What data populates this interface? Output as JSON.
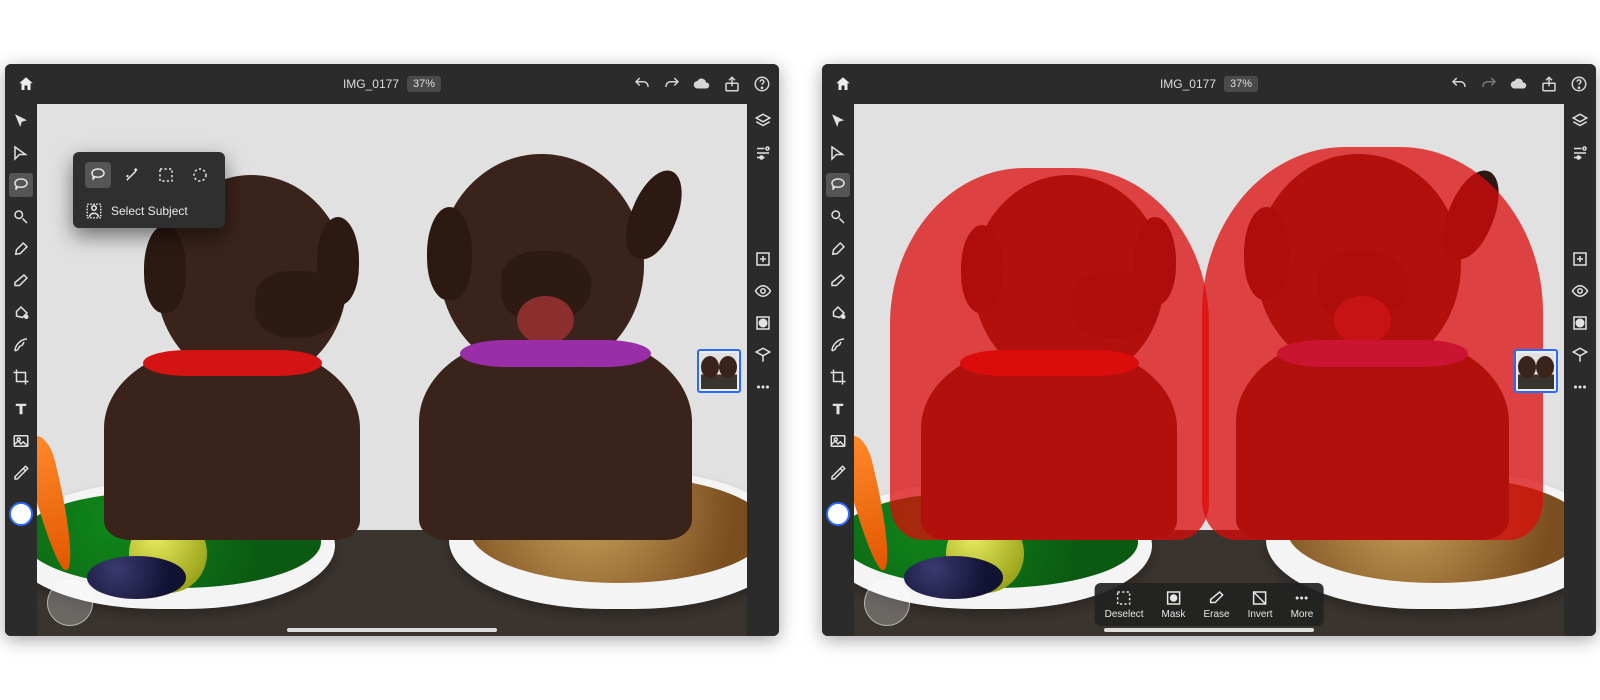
{
  "header": {
    "filename": "IMG_0177",
    "zoom": "37%"
  },
  "left_tools": [
    {
      "id": "move",
      "name": "move-tool-icon"
    },
    {
      "id": "transform",
      "name": "transform-tool-icon"
    },
    {
      "id": "lasso",
      "name": "lasso-tool-icon"
    },
    {
      "id": "quick-select",
      "name": "quick-select-tool-icon"
    },
    {
      "id": "brush",
      "name": "brush-tool-icon"
    },
    {
      "id": "eraser",
      "name": "eraser-tool-icon"
    },
    {
      "id": "fill",
      "name": "fill-tool-icon"
    },
    {
      "id": "gradient",
      "name": "gradient-tool-icon"
    },
    {
      "id": "crop",
      "name": "crop-tool-icon"
    },
    {
      "id": "type",
      "name": "type-tool-icon"
    },
    {
      "id": "place",
      "name": "place-image-tool-icon"
    },
    {
      "id": "eyedropper",
      "name": "eyedropper-tool-icon"
    }
  ],
  "right_tools": [
    {
      "id": "layers",
      "name": "layers-panel-icon"
    },
    {
      "id": "properties",
      "name": "properties-panel-icon"
    },
    {
      "id": "add",
      "name": "add-layer-icon"
    },
    {
      "id": "visible",
      "name": "visibility-icon"
    },
    {
      "id": "mask",
      "name": "mask-icon"
    },
    {
      "id": "fx",
      "name": "fx-icon"
    },
    {
      "id": "more",
      "name": "more-icon"
    }
  ],
  "top_right": [
    {
      "id": "undo",
      "name": "undo-icon",
      "dim": false
    },
    {
      "id": "redo",
      "name": "redo-icon",
      "dim": true
    },
    {
      "id": "cloud",
      "name": "cloud-sync-icon",
      "dim": false
    },
    {
      "id": "share",
      "name": "share-icon",
      "dim": false
    },
    {
      "id": "help",
      "name": "help-icon",
      "dim": false
    }
  ],
  "flyout": {
    "options": [
      {
        "id": "lasso",
        "name": "lasso-option-icon",
        "selected": true
      },
      {
        "id": "magic-wand",
        "name": "magic-wand-option-icon",
        "selected": false
      },
      {
        "id": "marquee-rect",
        "name": "rect-marquee-option-icon",
        "selected": false
      },
      {
        "id": "marquee-ellipse",
        "name": "ellipse-marquee-option-icon",
        "selected": false
      }
    ],
    "select_subject_label": "Select Subject"
  },
  "selection_toolbar": {
    "items": [
      {
        "id": "deselect",
        "label": "Deselect",
        "name": "deselect-icon"
      },
      {
        "id": "mask",
        "label": "Mask",
        "name": "mask-action-icon"
      },
      {
        "id": "erase",
        "label": "Erase",
        "name": "erase-action-icon"
      },
      {
        "id": "invert",
        "label": "Invert",
        "name": "invert-action-icon"
      },
      {
        "id": "more",
        "label": "More",
        "name": "more-action-icon"
      }
    ]
  },
  "colors": {
    "accent": "#2a6bff",
    "selection_overlay": "rgba(220,10,10,.74)",
    "chrome": "#2b2b2b",
    "canvas": "#1b1b1b"
  },
  "panelA": {
    "active_tool": "lasso",
    "shows_flyout": true,
    "shows_selection_overlay": false,
    "shows_sel_toolbar": false,
    "redo_dim": false
  },
  "panelB": {
    "active_tool": "lasso",
    "shows_flyout": false,
    "shows_selection_overlay": true,
    "shows_sel_toolbar": true,
    "redo_dim": true
  }
}
